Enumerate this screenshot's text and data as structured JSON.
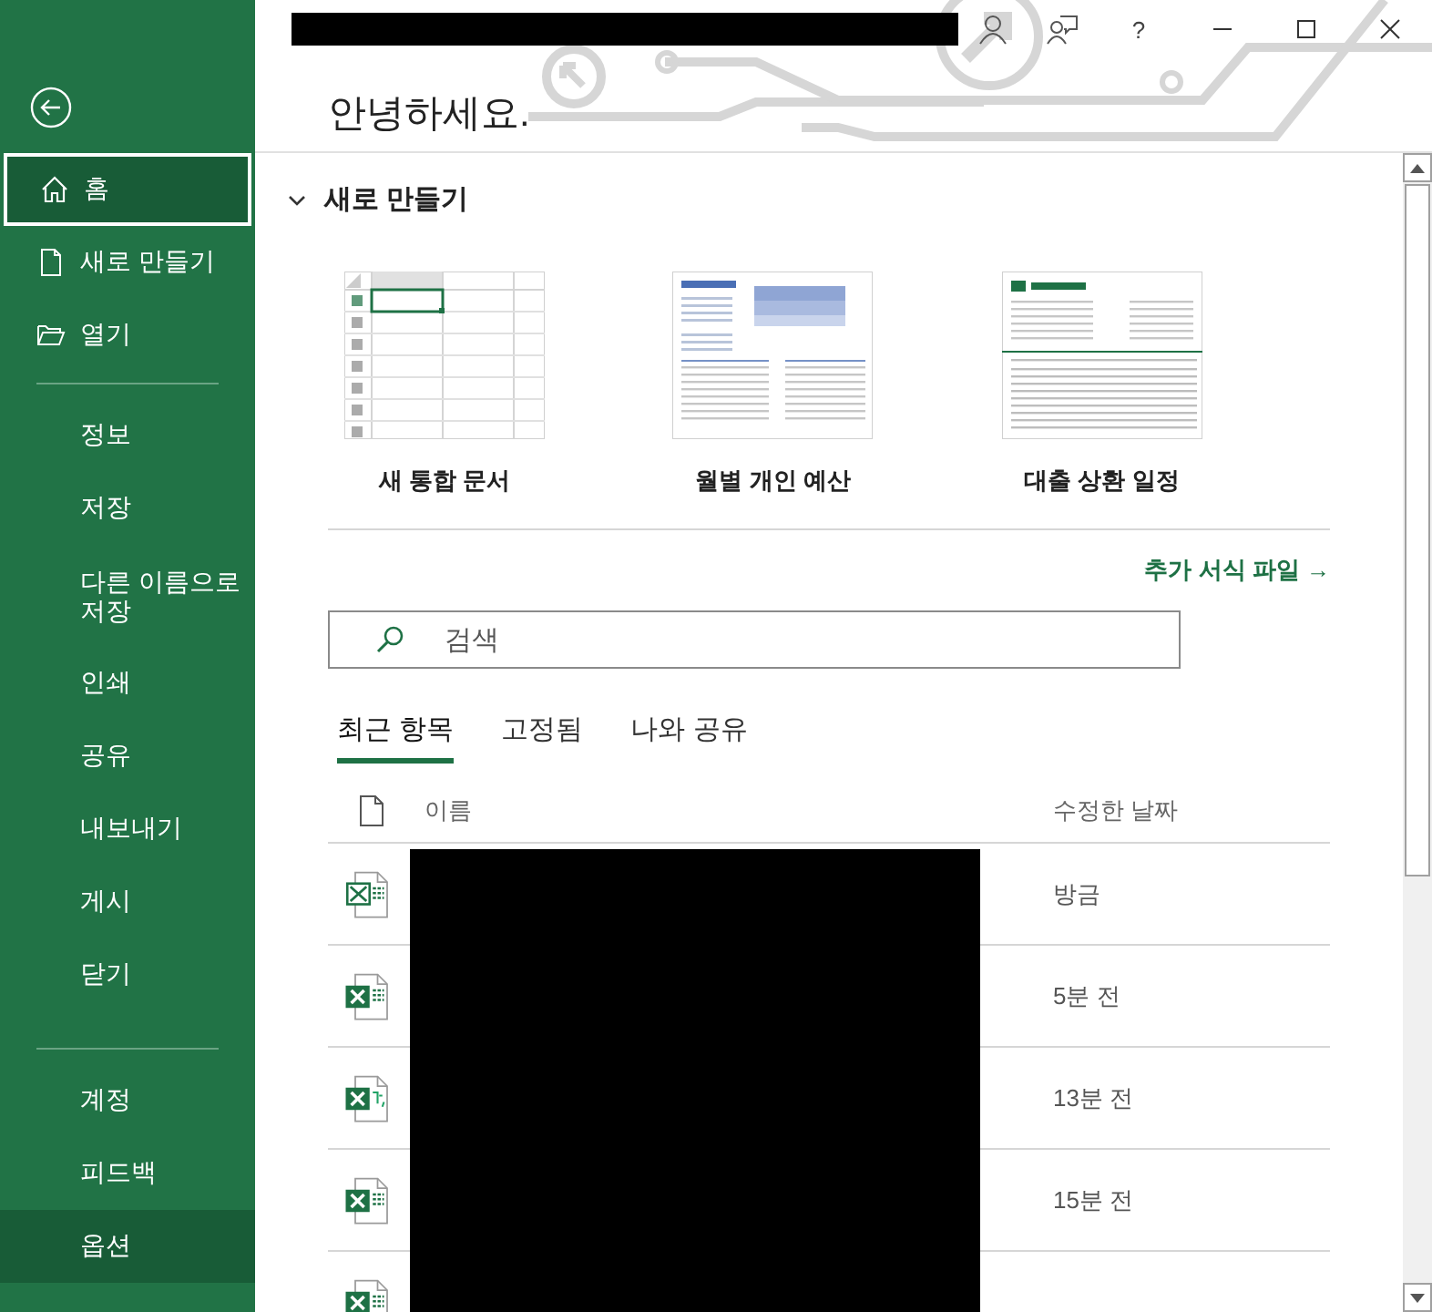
{
  "sidebar": {
    "items": [
      {
        "label": "홈",
        "selected": true,
        "highlighted": false
      },
      {
        "label": "새로 만들기",
        "selected": false,
        "highlighted": false
      },
      {
        "label": "열기",
        "selected": false,
        "highlighted": false
      },
      {
        "label": "정보",
        "selected": false,
        "highlighted": false
      },
      {
        "label": "저장",
        "selected": false,
        "highlighted": false
      },
      {
        "label": "다른 이름으로 저장",
        "selected": false,
        "highlighted": false
      },
      {
        "label": "인쇄",
        "selected": false,
        "highlighted": false
      },
      {
        "label": "공유",
        "selected": false,
        "highlighted": false
      },
      {
        "label": "내보내기",
        "selected": false,
        "highlighted": false
      },
      {
        "label": "게시",
        "selected": false,
        "highlighted": false
      },
      {
        "label": "닫기",
        "selected": false,
        "highlighted": false
      },
      {
        "label": "계정",
        "selected": false,
        "highlighted": false
      },
      {
        "label": "피드백",
        "selected": false,
        "highlighted": false
      },
      {
        "label": "옵션",
        "selected": false,
        "highlighted": true
      }
    ]
  },
  "title_bar": {
    "buttons": [
      "?"
    ]
  },
  "greeting": "안녕하세요.",
  "new_section": {
    "title": "새로 만들기",
    "expanded": true,
    "templates": [
      {
        "label": "새 통합 문서",
        "kind": "blank"
      },
      {
        "label": "월별 개인 예산",
        "kind": "budget"
      },
      {
        "label": "대출 상환 일정",
        "kind": "loan"
      }
    ],
    "more_link": "추가 서식 파일 →"
  },
  "search": {
    "placeholder": "검색"
  },
  "tabs": [
    {
      "label": "최근 항목",
      "selected": true
    },
    {
      "label": "고정됨",
      "selected": false
    },
    {
      "label": "나와 공유",
      "selected": false
    }
  ],
  "table": {
    "columns": [
      "이름",
      "수정한 날짜"
    ],
    "rows": [
      {
        "kind": "template",
        "modified": "방금"
      },
      {
        "kind": "workbook",
        "modified": "5분 전"
      },
      {
        "kind": "text",
        "modified": "13분 전"
      },
      {
        "kind": "workbook",
        "modified": "15분 전"
      },
      {
        "kind": "workbook"
      }
    ]
  }
}
